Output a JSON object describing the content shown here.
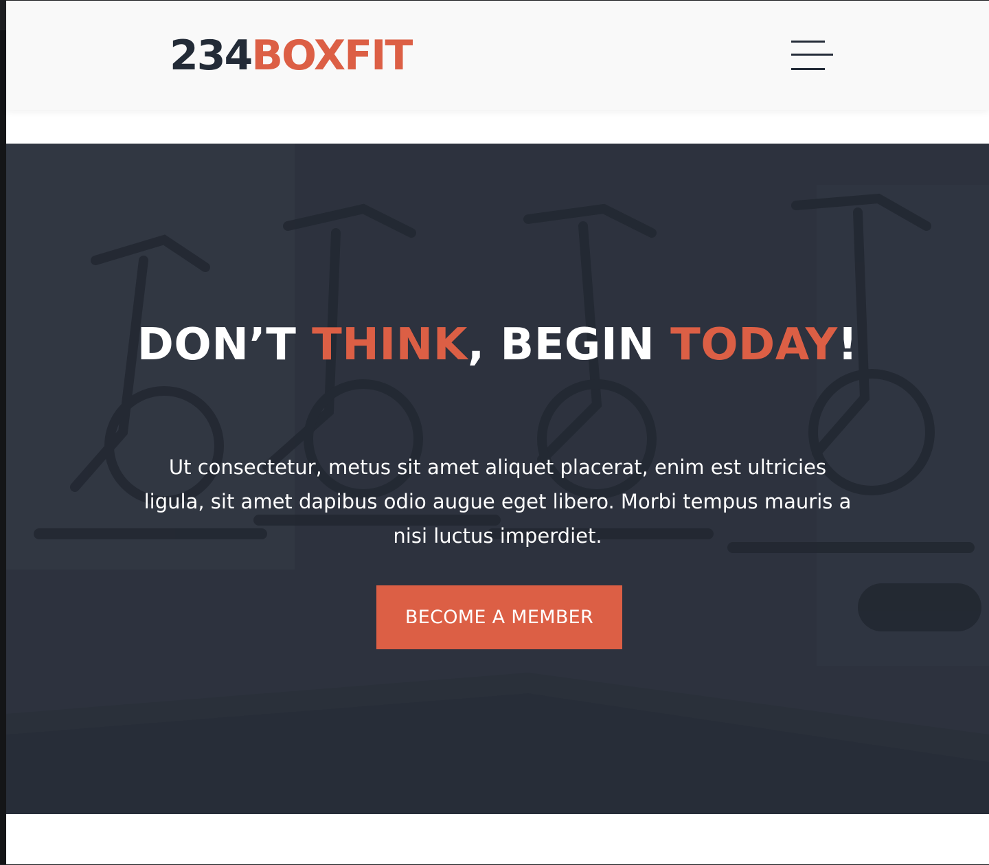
{
  "brand": {
    "logo_number": "234",
    "logo_word": "BOXFIT"
  },
  "header": {
    "menu_icon": "hamburger-menu-icon"
  },
  "hero": {
    "headline": {
      "part1": "DON’T ",
      "accent1": "THINK",
      "part2": ", BEGIN ",
      "accent2": "TODAY",
      "part3": "!"
    },
    "subtext": "Ut consectetur, metus sit amet aliquet placerat, enim est ultricies ligula, sit amet dapibus odio augue eget libero. Morbi tempus mauris a nisi luctus imperdiet.",
    "cta_label": "BECOME A MEMBER",
    "background": "gym-spin-bikes-photo"
  },
  "colors": {
    "accent": "#dc5f45",
    "dark": "#232b37",
    "hero_overlay": "#2c323d",
    "header_bg": "#f9f9f9"
  }
}
